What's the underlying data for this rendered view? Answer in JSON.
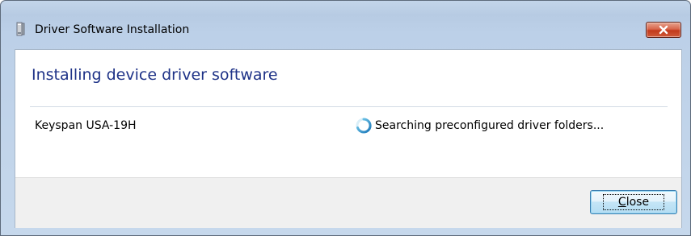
{
  "window": {
    "title": "Driver Software Installation",
    "close_icon": "close-x-icon"
  },
  "main": {
    "heading": "Installing device driver software",
    "devices": [
      {
        "name": "Keyspan USA-19H",
        "status": "Searching preconfigured driver folders...",
        "status_icon": "busy-spinner-icon"
      }
    ]
  },
  "footer": {
    "close_button": {
      "mnemonic": "C",
      "rest": "lose"
    }
  },
  "colors": {
    "heading": "#1e3287",
    "titlebar_close": "#c2391b",
    "button_border": "#3c7fb1"
  }
}
